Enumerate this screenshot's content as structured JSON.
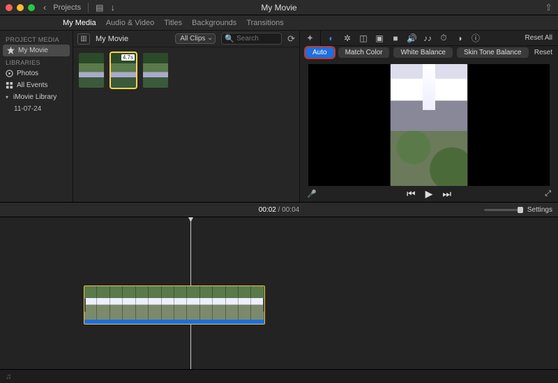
{
  "titlebar": {
    "back_label": "Projects",
    "title": "My Movie",
    "share_icon": "share-icon"
  },
  "tabs": {
    "items": [
      "My Media",
      "Audio & Video",
      "Titles",
      "Backgrounds",
      "Transitions"
    ],
    "active": 0
  },
  "sidebar": {
    "project_media_hdr": "PROJECT MEDIA",
    "project": "My Movie",
    "libraries_hdr": "LIBRARIES",
    "photos": "Photos",
    "all_events": "All Events",
    "library": "iMovie Library",
    "event": "11-07-24"
  },
  "media_toolbar": {
    "title": "My Movie",
    "filter": "All Clips",
    "search_placeholder": "Search"
  },
  "thumbnails": {
    "selected_duration": "4.7s"
  },
  "preview_tools": {
    "reset_all": "Reset All"
  },
  "color_correction": {
    "auto": "Auto",
    "match": "Match Color",
    "wb": "White Balance",
    "skin": "Skin Tone Balance",
    "reset": "Reset"
  },
  "timecode": {
    "current": "00:02",
    "total": "00:04"
  },
  "timeline": {
    "settings": "Settings",
    "clip_frame_count": 14
  }
}
